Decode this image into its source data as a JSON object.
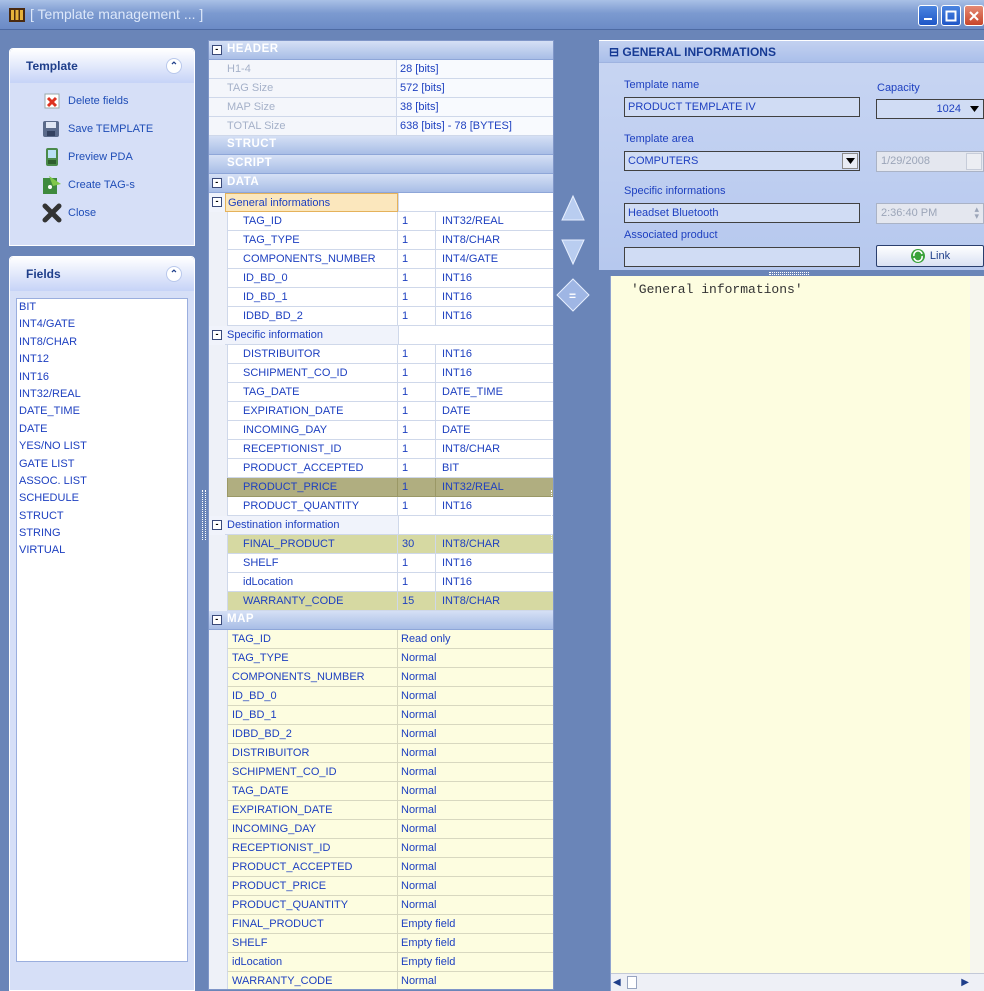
{
  "window": {
    "title": "[ Template management ... ]"
  },
  "template_panel": {
    "title": "Template",
    "items": [
      {
        "label": "Delete fields",
        "icon": "delete-fields-icon"
      },
      {
        "label": "Save TEMPLATE",
        "icon": "save-icon"
      },
      {
        "label": "Preview PDA",
        "icon": "pda-icon"
      },
      {
        "label": "Create TAG-s",
        "icon": "create-tags-icon"
      },
      {
        "label": "Close",
        "icon": "close-x-icon"
      }
    ]
  },
  "fields_panel": {
    "title": "Fields",
    "items": [
      "BIT",
      "INT4/GATE",
      "INT8/CHAR",
      "INT12",
      "INT16",
      "INT32/REAL",
      "DATE_TIME",
      "DATE",
      "YES/NO LIST",
      "GATE LIST",
      "ASSOC. LIST",
      "SCHEDULE",
      "STRUCT",
      "STRING",
      "VIRTUAL"
    ]
  },
  "grid": {
    "header_section": "HEADER",
    "header_rows": [
      {
        "key": "H1-4",
        "value": "28 [bits]"
      },
      {
        "key": "TAG Size",
        "value": "572 [bits]"
      },
      {
        "key": "MAP Size",
        "value": "38 [bits]"
      },
      {
        "key": "TOTAL Size",
        "value": "638 [bits] - 78 [BYTES]"
      }
    ],
    "struct_section": "STRUCT",
    "script_section": "SCRIPT",
    "data_section": "DATA",
    "groups": [
      {
        "name": "General informations",
        "fields": [
          {
            "name": "TAG_ID",
            "count": "1",
            "type": "INT32/REAL"
          },
          {
            "name": "TAG_TYPE",
            "count": "1",
            "type": "INT8/CHAR"
          },
          {
            "name": "COMPONENTS_NUMBER",
            "count": "1",
            "type": "INT4/GATE"
          },
          {
            "name": "ID_BD_0",
            "count": "1",
            "type": "INT16"
          },
          {
            "name": "ID_BD_1",
            "count": "1",
            "type": "INT16"
          },
          {
            "name": "IDBD_BD_2",
            "count": "1",
            "type": "INT16"
          }
        ]
      },
      {
        "name": "Specific information",
        "fields": [
          {
            "name": "DISTRIBUITOR",
            "count": "1",
            "type": "INT16"
          },
          {
            "name": "SCHIPMENT_CO_ID",
            "count": "1",
            "type": "INT16"
          },
          {
            "name": "TAG_DATE",
            "count": "1",
            "type": "DATE_TIME"
          },
          {
            "name": "EXPIRATION_DATE",
            "count": "1",
            "type": "DATE"
          },
          {
            "name": "INCOMING_DAY",
            "count": "1",
            "type": "DATE"
          },
          {
            "name": "RECEPTIONIST_ID",
            "count": "1",
            "type": "INT8/CHAR"
          },
          {
            "name": "PRODUCT_ACCEPTED",
            "count": "1",
            "type": "BIT"
          },
          {
            "name": "PRODUCT_PRICE",
            "count": "1",
            "type": "INT32/REAL"
          },
          {
            "name": "PRODUCT_QUANTITY",
            "count": "1",
            "type": "INT16"
          }
        ]
      },
      {
        "name": "Destination information",
        "fields": [
          {
            "name": "FINAL_PRODUCT",
            "count": "30",
            "type": "INT8/CHAR"
          },
          {
            "name": "SHELF",
            "count": "1",
            "type": "INT16"
          },
          {
            "name": "idLocation",
            "count": "1",
            "type": "INT16"
          },
          {
            "name": "WARRANTY_CODE",
            "count": "15",
            "type": "INT8/CHAR"
          }
        ]
      }
    ],
    "map_section": "MAP",
    "map_rows": [
      {
        "name": "TAG_ID",
        "value": "Read only"
      },
      {
        "name": "TAG_TYPE",
        "value": "Normal"
      },
      {
        "name": "COMPONENTS_NUMBER",
        "value": "Normal"
      },
      {
        "name": "ID_BD_0",
        "value": "Normal"
      },
      {
        "name": "ID_BD_1",
        "value": "Normal"
      },
      {
        "name": "IDBD_BD_2",
        "value": "Normal"
      },
      {
        "name": "DISTRIBUITOR",
        "value": "Normal"
      },
      {
        "name": "SCHIPMENT_CO_ID",
        "value": "Normal"
      },
      {
        "name": "TAG_DATE",
        "value": "Normal"
      },
      {
        "name": "EXPIRATION_DATE",
        "value": "Normal"
      },
      {
        "name": "INCOMING_DAY",
        "value": "Normal"
      },
      {
        "name": "RECEPTIONIST_ID",
        "value": "Normal"
      },
      {
        "name": "PRODUCT_ACCEPTED",
        "value": "Normal"
      },
      {
        "name": "PRODUCT_PRICE",
        "value": "Normal"
      },
      {
        "name": "PRODUCT_QUANTITY",
        "value": "Normal"
      },
      {
        "name": "FINAL_PRODUCT",
        "value": "Empty field"
      },
      {
        "name": "SHELF",
        "value": "Empty field"
      },
      {
        "name": "idLocation",
        "value": "Empty field"
      },
      {
        "name": "WARRANTY_CODE",
        "value": "Normal"
      }
    ]
  },
  "info": {
    "title": "GENERAL INFORMATIONS",
    "template_name_label": "Template name",
    "template_name": "PRODUCT TEMPLATE IV",
    "capacity_label": "Capacity",
    "capacity": "1024",
    "template_area_label": "Template area",
    "template_area": "COMPUTERS",
    "date": "1/29/2008",
    "specific_label": "Specific informations",
    "specific": "Headset Bluetooth",
    "time": "2:36:40 PM",
    "associated_label": "Associated  product",
    "associated": "",
    "link_label": "Link"
  },
  "script": {
    "text": "'General informations'"
  },
  "colors": {
    "accent": "#1e40c0",
    "selection": "#fbe7bd",
    "highlight": "#d6d9a2",
    "script_bg": "#fdfde0"
  }
}
